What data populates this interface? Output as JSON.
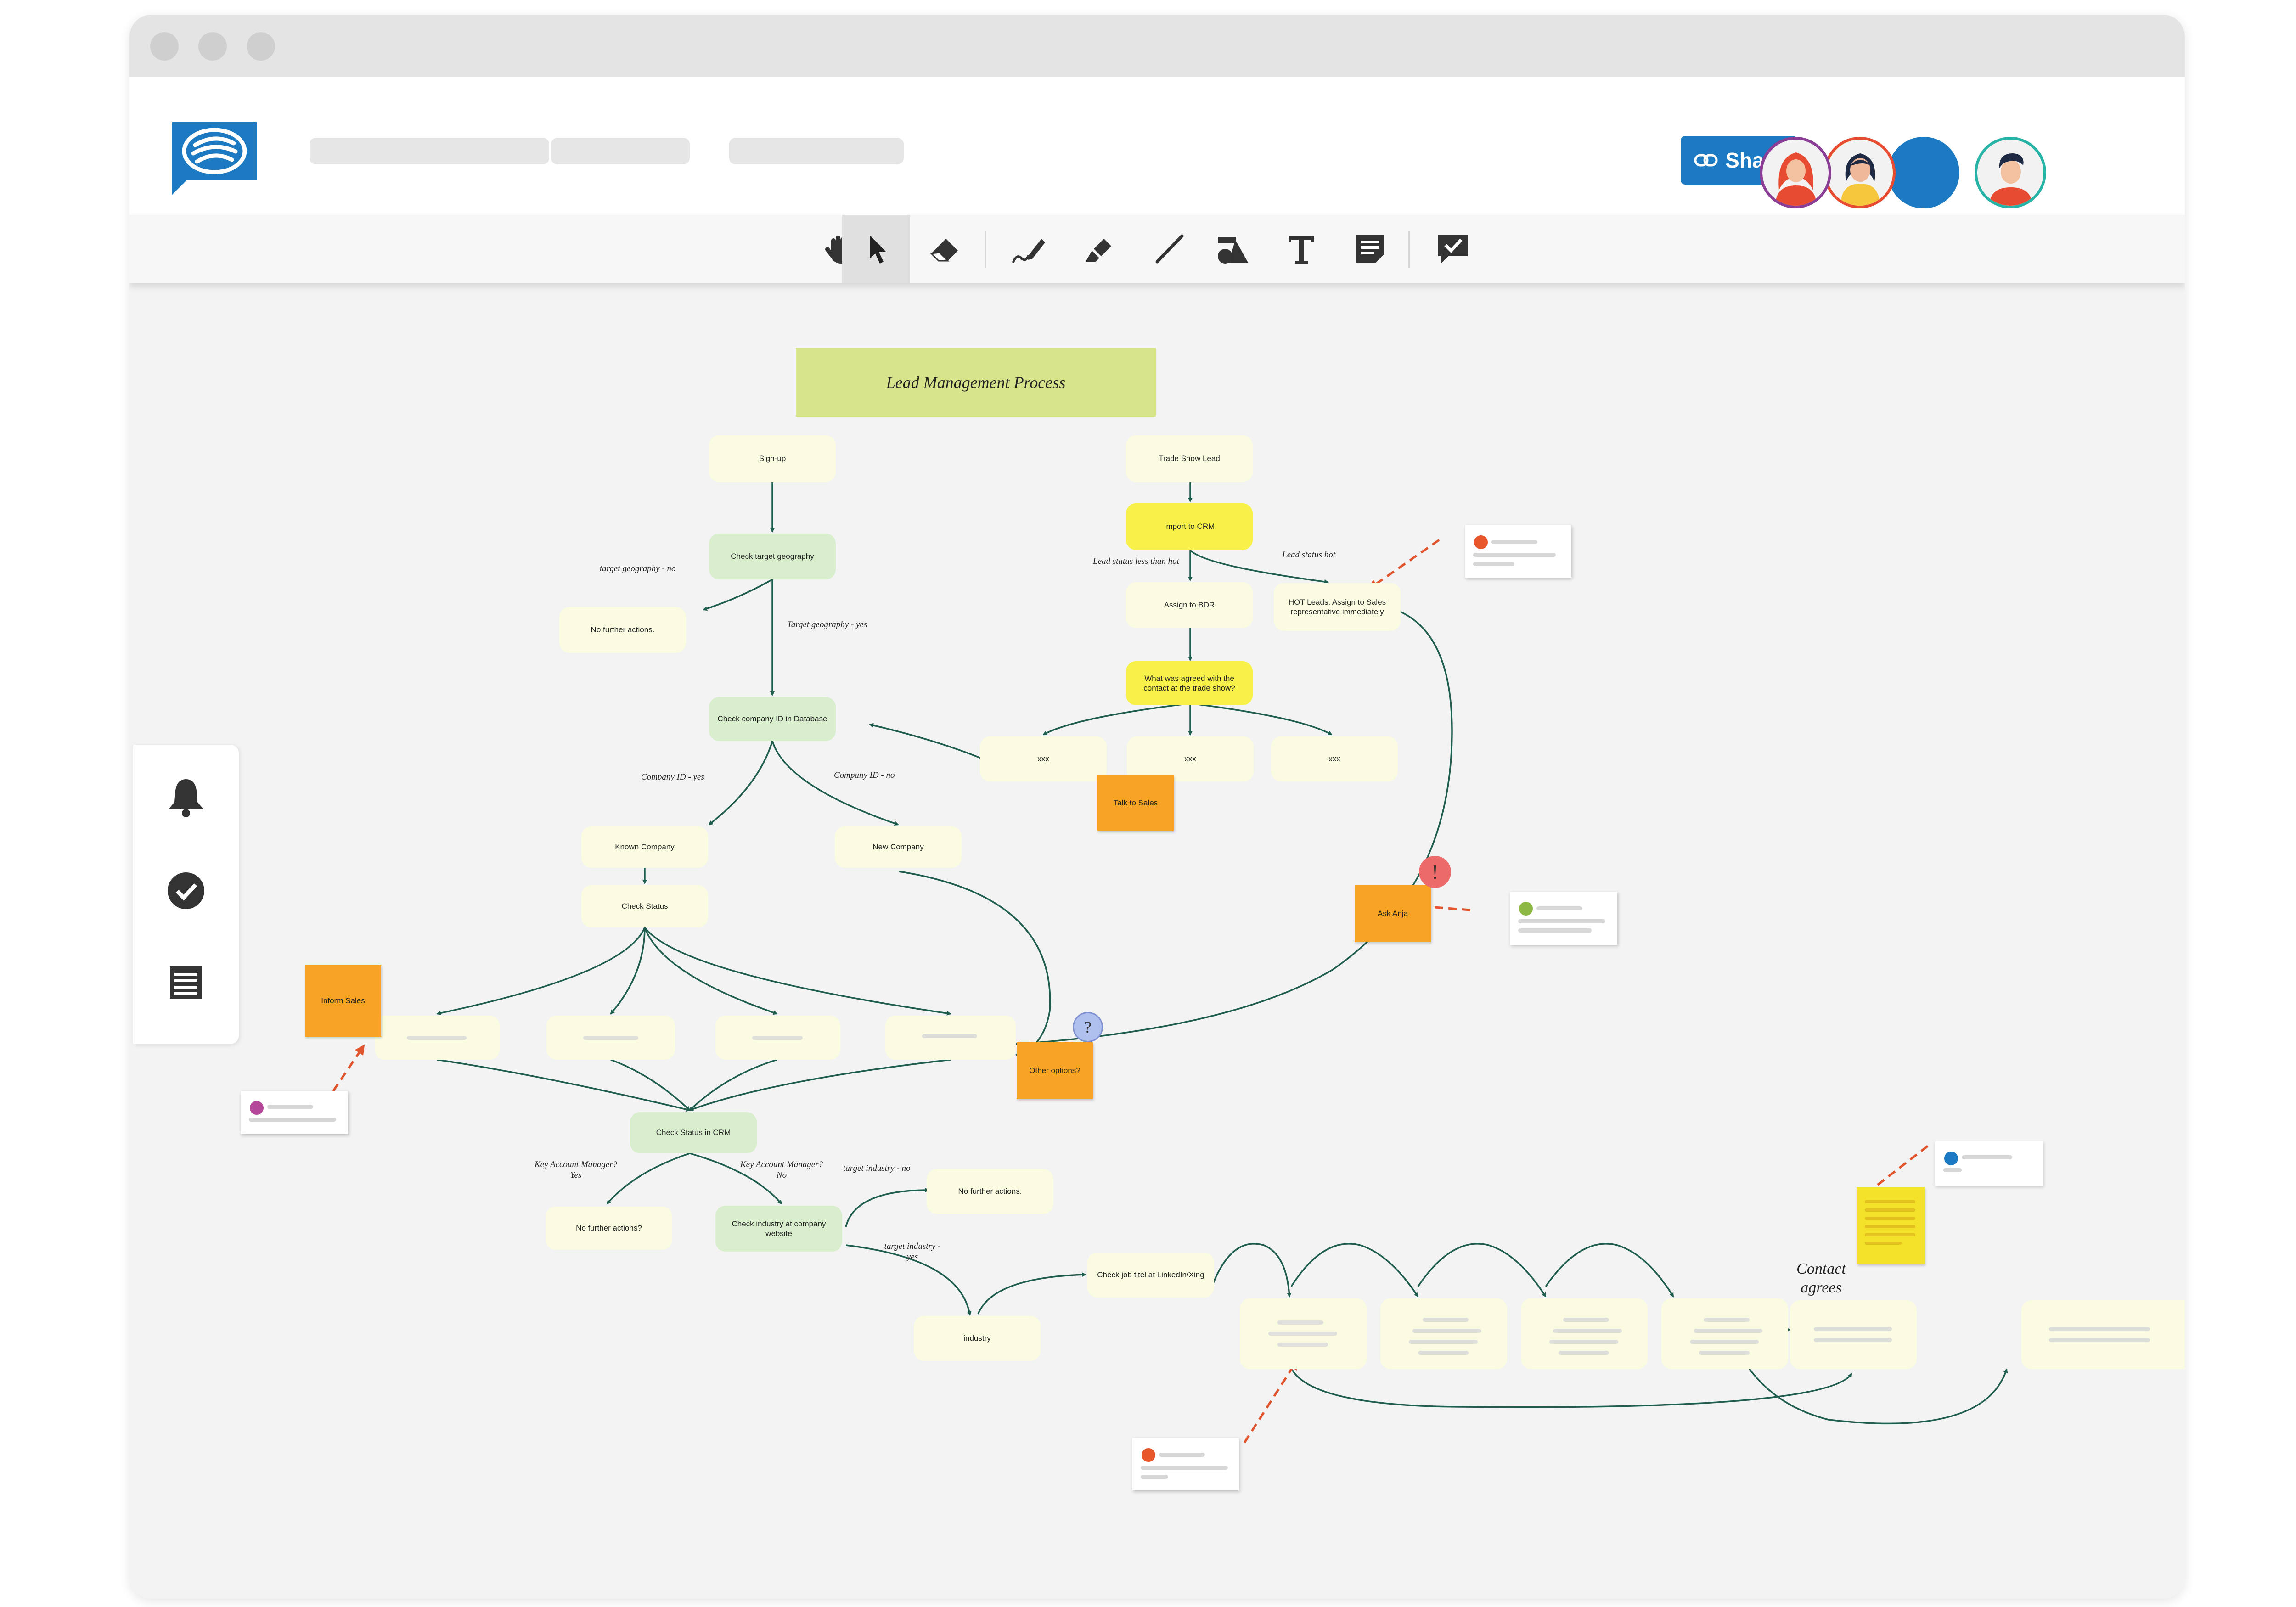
{
  "header": {
    "share_label": "Share",
    "share_icon": "link-icon"
  },
  "toolbar": {
    "tools": [
      "hand-icon",
      "pointer-icon",
      "eraser-icon",
      "pen-icon",
      "highlighter-icon",
      "line-icon",
      "shapes-icon",
      "text-icon",
      "sticky-note-icon",
      "comment-icon"
    ],
    "active_tool": "pointer-icon"
  },
  "side_panel": {
    "items": [
      "bell-icon",
      "check-circle-icon",
      "list-icon"
    ]
  },
  "colors": {
    "accent": "#1c7ac2",
    "connector": "#1f5e4e",
    "pointer_arrow": "#e0542e",
    "sticky_orange": "#f7a323"
  },
  "diagram": {
    "title": "Lead Management Process",
    "nodes": {
      "signup": "Sign-up",
      "check_geo": "Check target geography",
      "no_action_1": "No further actions.",
      "check_company_id": "Check company ID in Database",
      "known_company": "Known Company",
      "new_company": "New Company",
      "check_status": "Check Status",
      "check_status_crm": "Check Status in CRM",
      "no_action_2": "No further actions?",
      "check_industry": "Check industry at company website",
      "no_action_3": "No further actions.",
      "industry": "industry",
      "check_job": "Check job titel at LinkedIn/Xing",
      "trade_show": "Trade Show Lead",
      "import_crm": "Import to CRM",
      "assign_bdr": "Assign to BDR",
      "hot_leads": "HOT Leads. Assign to Sales representative immediately",
      "what_agreed": "What was agreed with the contact at the trade show?",
      "xxx_1": "xxx",
      "xxx_2": "xxx",
      "xxx_3": "xxx"
    },
    "stickies": {
      "talk_sales": "Talk to Sales",
      "ask_anja": "Ask Anja",
      "inform_sales": "Inform Sales",
      "other_options": "Other options?"
    },
    "labels": {
      "geo_no": "target geography - no",
      "geo_yes": "Target geography - yes",
      "company_yes": "Company ID - yes",
      "company_no": "Company ID - no",
      "lead_less_hot": "Lead status less than hot",
      "lead_hot": "Lead status hot",
      "kam_yes_q": "Key Account Manager?",
      "kam_yes": "Yes",
      "kam_no_q": "Key Account Manager?",
      "kam_no": "No",
      "industry_no": "target industry - no",
      "industry_yes_1": "target industry -",
      "industry_yes_2": "yes",
      "contact_1": "Contact",
      "contact_2": "agrees"
    },
    "markers": {
      "alert": "!",
      "question": "?"
    }
  }
}
